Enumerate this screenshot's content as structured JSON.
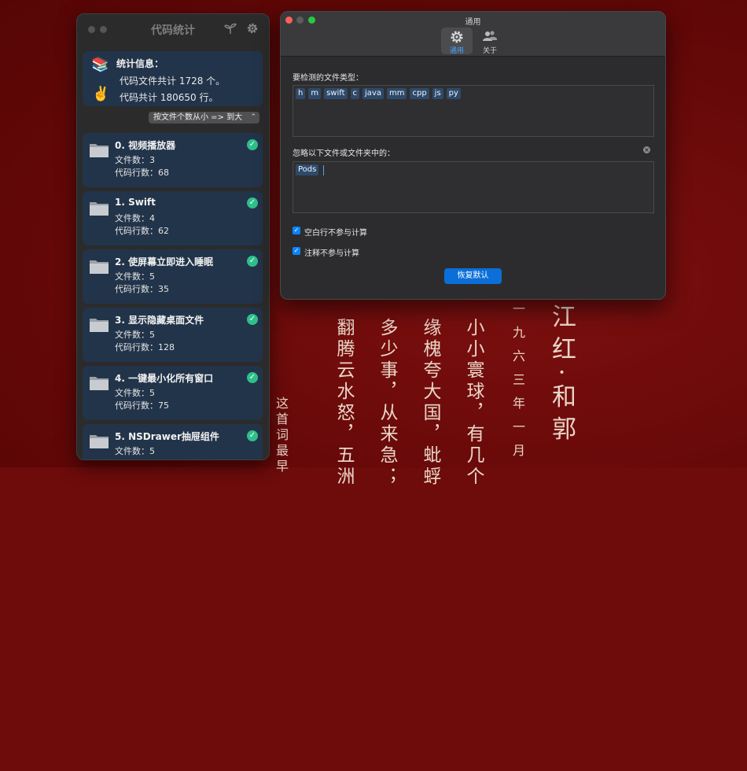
{
  "wallpaper": {
    "poem_columns": [
      "江红·和郭",
      "一九六三年一月",
      "小小寰球，有几个",
      "缘槐夸大国，蚍蜉",
      "多少事，从来急；",
      "翻腾云水怒，五洲",
      "这首词最早"
    ]
  },
  "counter_window": {
    "title": "代码统计",
    "stats": {
      "heading": "统计信息：",
      "files_total": "代码文件共计 1728 个。",
      "lines_total": "代码共计 180650 行。",
      "books_emoji": "📚",
      "victory_emoji": "✌️"
    },
    "sort_select": {
      "value": "按文件个数从小 => 到大"
    },
    "projects": [
      {
        "name": "0. 视频播放器",
        "files": "文件数：3",
        "lines": "代码行数：68"
      },
      {
        "name": "1. Swift",
        "files": "文件数：4",
        "lines": "代码行数：62"
      },
      {
        "name": "2. 使屏幕立即进入睡眠",
        "files": "文件数：5",
        "lines": "代码行数：35"
      },
      {
        "name": "3. 显示隐藏桌面文件",
        "files": "文件数：5",
        "lines": "代码行数：128"
      },
      {
        "name": "4. 一键最小化所有窗口",
        "files": "文件数：5",
        "lines": "代码行数：75"
      },
      {
        "name": "5. NSDrawer抽屉组件",
        "files": "文件数：5",
        "lines": ""
      }
    ]
  },
  "settings_window": {
    "title": "通用",
    "tabs": [
      {
        "label": "通用",
        "icon": "gear-icon",
        "active": true
      },
      {
        "label": "关于",
        "icon": "people-icon",
        "active": false
      }
    ],
    "file_types_label": "要检测的文件类型：",
    "file_types": [
      "h",
      "m",
      "swift",
      "c",
      "java",
      "mm",
      "cpp",
      "js",
      "py"
    ],
    "ignore_label": "忽略以下文件或文件夹中的：",
    "ignore_items": [
      "Pods"
    ],
    "checkbox_blank_lines": "空白行不参与计算",
    "checkbox_comments": "注释不参与计算",
    "reset_button": "恢复默认",
    "colors": {
      "accent": "#0a84ff",
      "card_bg": "#22344a",
      "check_green": "#2fbf8a"
    }
  }
}
